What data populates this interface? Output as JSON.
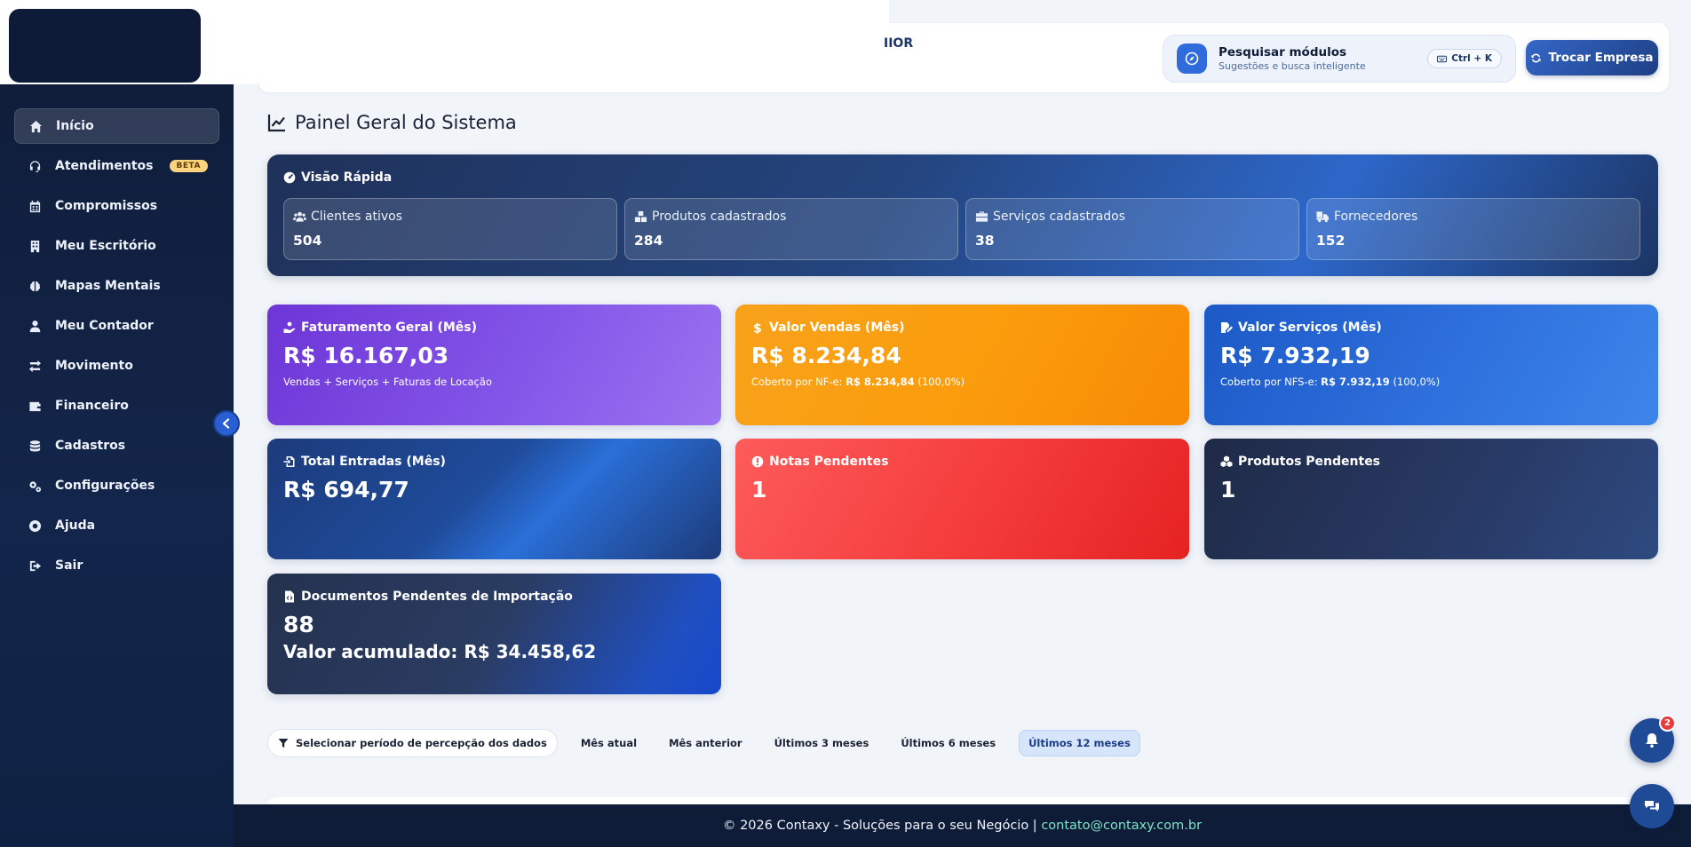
{
  "header": {
    "partial_text": "IIOR",
    "search_title": "Pesquisar módulos",
    "search_subtitle": "Sugestões e busca inteligente",
    "shortcut": "Ctrl + K",
    "switch_company": "Trocar Empresa"
  },
  "sidebar": {
    "items": [
      {
        "label": "Início",
        "icon": "home-icon"
      },
      {
        "label": "Atendimentos",
        "icon": "headset-icon",
        "badge": "BETA"
      },
      {
        "label": "Compromissos",
        "icon": "calendar-icon"
      },
      {
        "label": "Meu Escritório",
        "icon": "building-icon"
      },
      {
        "label": "Mapas Mentais",
        "icon": "brain-icon"
      },
      {
        "label": "Meu Contador",
        "icon": "user-icon"
      },
      {
        "label": "Movimento",
        "icon": "exchange-icon"
      },
      {
        "label": "Financeiro",
        "icon": "wallet-icon"
      },
      {
        "label": "Cadastros",
        "icon": "database-icon"
      },
      {
        "label": "Configurações",
        "icon": "gears-icon"
      },
      {
        "label": "Ajuda",
        "icon": "lifebuoy-icon"
      },
      {
        "label": "Sair",
        "icon": "logout-icon"
      }
    ]
  },
  "page": {
    "title": "Painel Geral do Sistema"
  },
  "quick_view": {
    "title": "Visão Rápida",
    "cards": [
      {
        "label": "Clientes ativos",
        "value": "504",
        "icon": "users-icon"
      },
      {
        "label": "Produtos cadastrados",
        "value": "284",
        "icon": "boxes-icon"
      },
      {
        "label": "Serviços cadastrados",
        "value": "38",
        "icon": "briefcase-icon"
      },
      {
        "label": "Fornecedores",
        "value": "152",
        "icon": "truck-icon"
      }
    ]
  },
  "cards": {
    "faturamento": {
      "label": "Faturamento Geral (Mês)",
      "value": "R$ 16.167,03",
      "sub": "Vendas + Serviços + Faturas de Locação"
    },
    "vendas": {
      "label": "Valor Vendas (Mês)",
      "value": "R$ 8.234,84",
      "sub_prefix": "Coberto por NF-e:",
      "sub_value": "R$ 8.234,84",
      "sub_suffix": "(100,0%)"
    },
    "servicos": {
      "label": "Valor Serviços (Mês)",
      "value": "R$ 7.932,19",
      "sub_prefix": "Coberto por NFS-e:",
      "sub_value": "R$ 7.932,19",
      "sub_suffix": "(100,0%)"
    },
    "entradas": {
      "label": "Total Entradas (Mês)",
      "value": "R$ 694,77"
    },
    "notas": {
      "label": "Notas Pendentes",
      "value": "1"
    },
    "produtos": {
      "label": "Produtos Pendentes",
      "value": "1"
    },
    "documentos": {
      "label": "Documentos Pendentes de Importação",
      "value": "88",
      "sub": "Valor acumulado: R$ 34.458,62"
    }
  },
  "period": {
    "label": "Selecionar período de percepção dos dados",
    "options": [
      "Mês atual",
      "Mês anterior",
      "Últimos 3 meses",
      "Últimos 6 meses",
      "Últimos 12 meses"
    ],
    "selected": "Últimos 12 meses"
  },
  "footer": {
    "text": "© 2026 Contaxy - Soluções para o seu Negócio |",
    "email": "contato@contaxy.com.br"
  },
  "notifications": {
    "count": "2"
  }
}
